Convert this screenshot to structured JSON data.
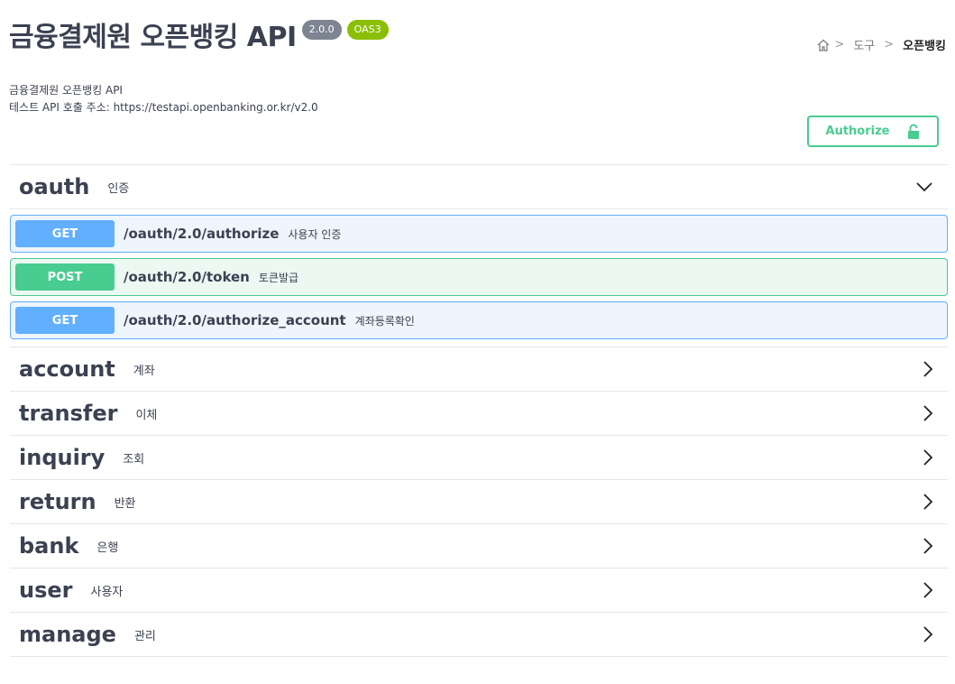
{
  "header": {
    "title": "금융결제원 오픈뱅킹 API",
    "version_badge": "2.0.0",
    "oas_badge": "OAS3",
    "description_line1": "금융결제원 오픈뱅킹 API",
    "description_line2": "테스트 API 호출 주소: https://testapi.openbanking.or.kr/v2.0"
  },
  "breadcrumb": {
    "items": [
      "도구",
      "오픈뱅킹"
    ],
    "separator": ">"
  },
  "authorize": {
    "label": "Authorize"
  },
  "sections": [
    {
      "name": "oauth",
      "description": "인증",
      "expanded": true,
      "operations": [
        {
          "method": "GET",
          "path": "/oauth/2.0/authorize",
          "summary": "사용자 인증"
        },
        {
          "method": "POST",
          "path": "/oauth/2.0/token",
          "summary": "토큰발급"
        },
        {
          "method": "GET",
          "path": "/oauth/2.0/authorize_account",
          "summary": "계좌등록확인"
        }
      ]
    },
    {
      "name": "account",
      "description": "계좌",
      "expanded": false
    },
    {
      "name": "transfer",
      "description": "이체",
      "expanded": false
    },
    {
      "name": "inquiry",
      "description": "조회",
      "expanded": false
    },
    {
      "name": "return",
      "description": "반환",
      "expanded": false
    },
    {
      "name": "bank",
      "description": "은행",
      "expanded": false
    },
    {
      "name": "user",
      "description": "사용자",
      "expanded": false
    },
    {
      "name": "manage",
      "description": "관리",
      "expanded": false
    }
  ],
  "colors": {
    "get": "#61affe",
    "post": "#49cc90",
    "version_badge": "#7d8492",
    "oas_badge": "#89bf04"
  },
  "icons": {
    "home": "home-icon",
    "lock": "lock-icon",
    "expanded": "chevron-down-icon",
    "collapsed": "chevron-right-icon"
  }
}
